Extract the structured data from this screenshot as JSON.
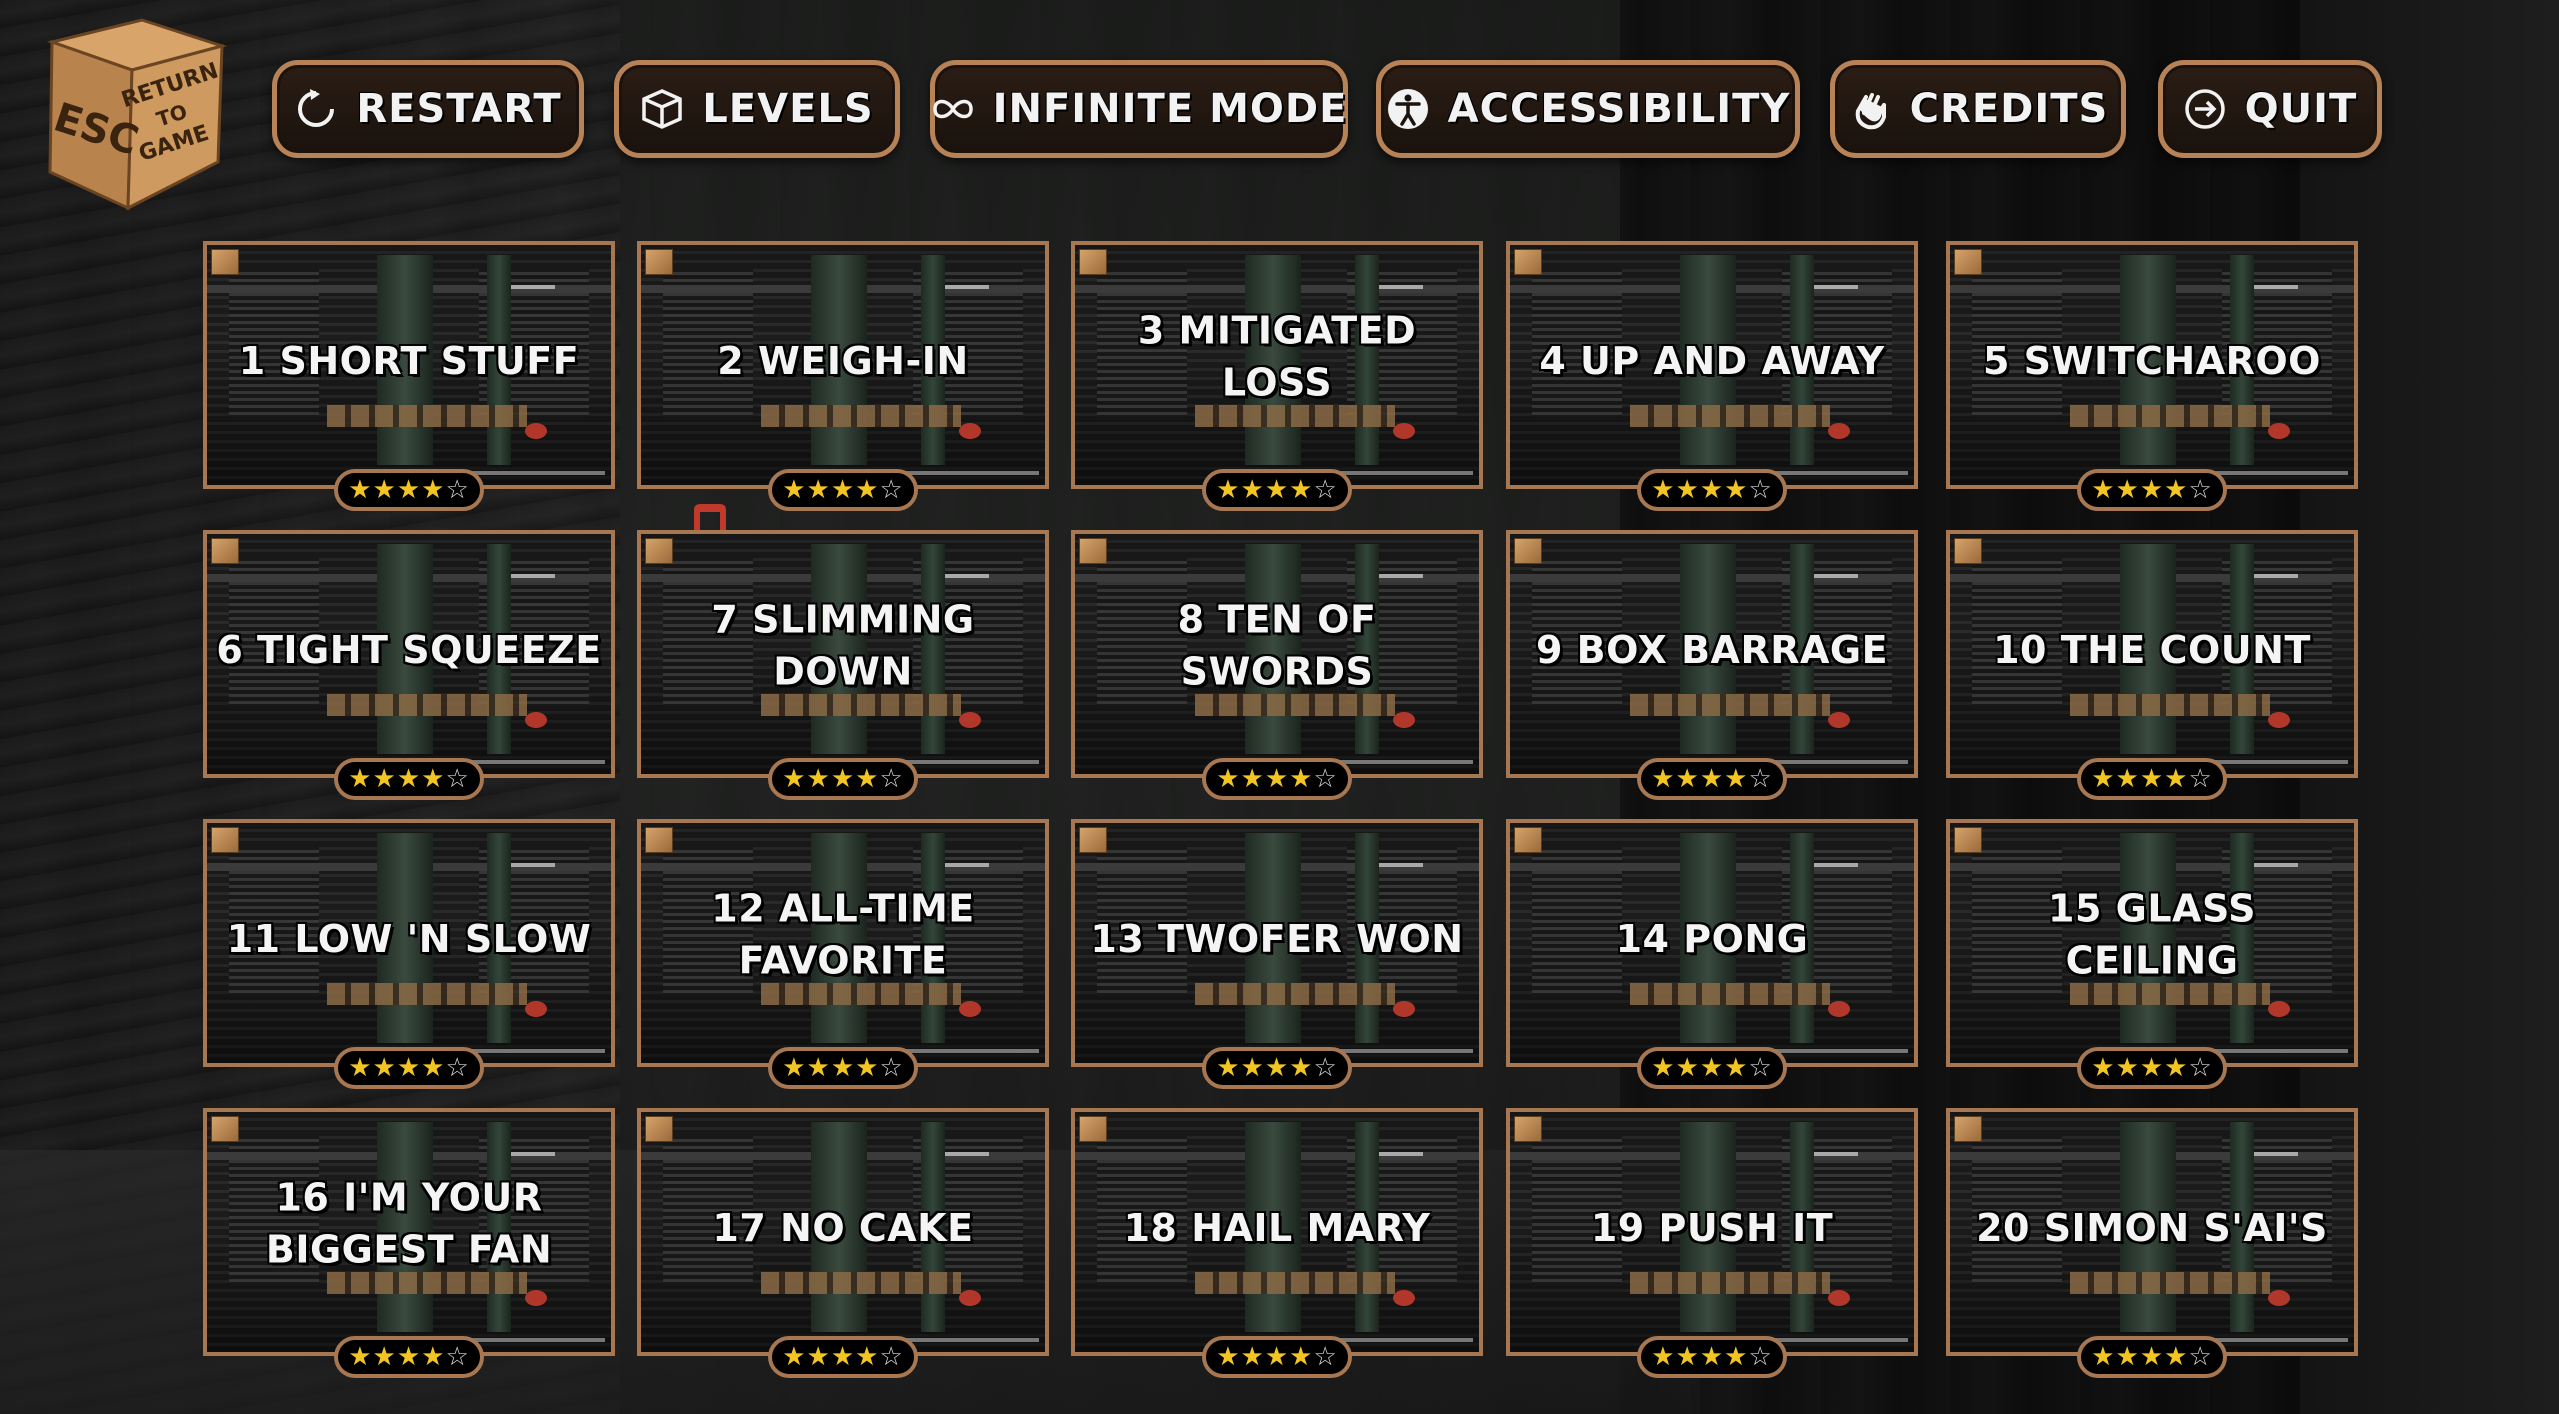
{
  "esc_button": {
    "key": "ESC",
    "label_lines": [
      "RETURN",
      "TO",
      "GAME"
    ]
  },
  "toolbar": [
    {
      "id": "restart",
      "label": "RESTART",
      "icon": "restart-icon"
    },
    {
      "id": "levels",
      "label": "LEVELS",
      "icon": "box-icon"
    },
    {
      "id": "infinite",
      "label": "INFINITE MODE",
      "icon": "infinity-icon"
    },
    {
      "id": "accessibility",
      "label": "ACCESSIBILITY",
      "icon": "accessibility-icon"
    },
    {
      "id": "credits",
      "label": "CREDITS",
      "icon": "wave-hand-icon"
    },
    {
      "id": "quit",
      "label": "QUIT",
      "icon": "exit-icon"
    }
  ],
  "levels": [
    {
      "number": 1,
      "title": "1 SHORT STUFF",
      "stars": 4,
      "max_stars": 5
    },
    {
      "number": 2,
      "title": "2 WEIGH-IN",
      "stars": 4,
      "max_stars": 5
    },
    {
      "number": 3,
      "title": "3 MITIGATED LOSS",
      "stars": 4,
      "max_stars": 5
    },
    {
      "number": 4,
      "title": "4 UP AND AWAY",
      "stars": 4,
      "max_stars": 5
    },
    {
      "number": 5,
      "title": "5 SWITCHAROO",
      "stars": 4,
      "max_stars": 5
    },
    {
      "number": 6,
      "title": "6 TIGHT SQUEEZE",
      "stars": 4,
      "max_stars": 5
    },
    {
      "number": 7,
      "title": "7 SLIMMING DOWN",
      "stars": 4,
      "max_stars": 5
    },
    {
      "number": 8,
      "title": "8 TEN OF SWORDS",
      "stars": 4,
      "max_stars": 5
    },
    {
      "number": 9,
      "title": "9 BOX BARRAGE",
      "stars": 4,
      "max_stars": 5
    },
    {
      "number": 10,
      "title": "10 THE COUNT",
      "stars": 4,
      "max_stars": 5
    },
    {
      "number": 11,
      "title": "11 LOW 'N SLOW",
      "stars": 4,
      "max_stars": 5
    },
    {
      "number": 12,
      "title": "12 ALL-TIME FAVORITE",
      "stars": 4,
      "max_stars": 5
    },
    {
      "number": 13,
      "title": "13 TWOFER WON",
      "stars": 4,
      "max_stars": 5
    },
    {
      "number": 14,
      "title": "14 PONG",
      "stars": 4,
      "max_stars": 5
    },
    {
      "number": 15,
      "title": "15 GLASS CEILING",
      "stars": 4,
      "max_stars": 5
    },
    {
      "number": 16,
      "title": "16 I'M YOUR BIGGEST FAN",
      "stars": 4,
      "max_stars": 5
    },
    {
      "number": 17,
      "title": "17 NO CAKE",
      "stars": 4,
      "max_stars": 5
    },
    {
      "number": 18,
      "title": "18 HAIL MARY",
      "stars": 4,
      "max_stars": 5
    },
    {
      "number": 19,
      "title": "19 PUSH IT",
      "stars": 4,
      "max_stars": 5
    },
    {
      "number": 20,
      "title": "20 SIMON S'AI'S",
      "stars": 4,
      "max_stars": 5
    }
  ],
  "colors": {
    "frame": "#a77752",
    "star_filled": "#f3c523",
    "star_empty": "#d9d9d9",
    "button_fill": "#1a120d"
  }
}
